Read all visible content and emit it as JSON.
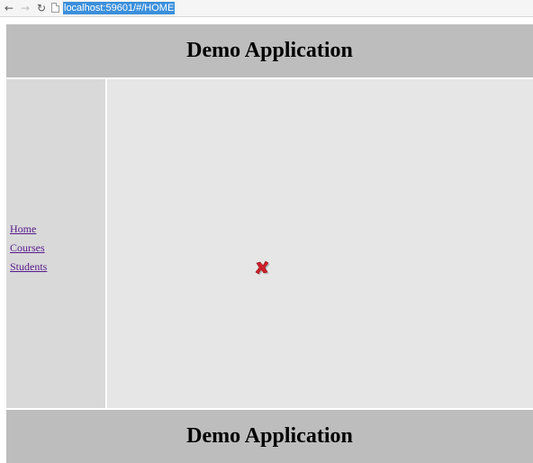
{
  "browser": {
    "back_icon": "back-arrow-icon",
    "forward_icon": "forward-arrow-icon",
    "reload_icon": "reload-icon",
    "url": "localhost:59601/#/HOME",
    "url_highlight_color": "#3b8fdb"
  },
  "header": {
    "title": "Demo Application",
    "background": "#bdbdbd"
  },
  "sidebar": {
    "background": "#d9d9d9",
    "items": [
      {
        "label": "Home"
      },
      {
        "label": "Courses"
      },
      {
        "label": "Students"
      }
    ],
    "link_color": "#551a8b"
  },
  "main": {
    "background": "#e6e6e6",
    "image_icon": "broken-image-icon",
    "icon_color": "#d0202a"
  },
  "footer": {
    "title": "Demo Application",
    "background": "#bdbdbd"
  }
}
